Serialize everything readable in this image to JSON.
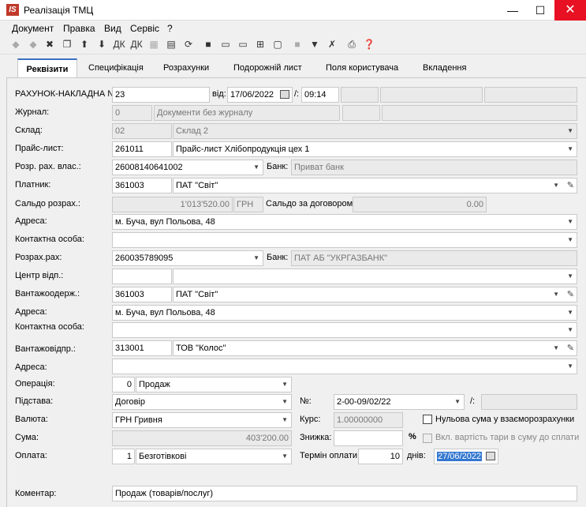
{
  "window": {
    "title": "Реалізація ТМЦ",
    "icon": "IS"
  },
  "menu": [
    "Документ",
    "Правка",
    "Вид",
    "Сервіс",
    "?"
  ],
  "tabs": [
    "Реквізити",
    "Специфікація",
    "Розрахунки",
    "Подорожній лист",
    "Поля користувача",
    "Вкладення"
  ],
  "labels": {
    "invoice": "РАХУНОК-НАКЛАДНА №:",
    "from": "від:",
    "slash": "/:",
    "journal": "Журнал:",
    "warehouse": "Склад:",
    "pricelist": "Прайс-лист:",
    "own_account": "Розр. рах. влас.:",
    "bank": "Банк:",
    "payer": "Платник:",
    "balance": "Сальдо розрах.:",
    "balance_contract": "Сальдо за договором:",
    "address": "Адреса:",
    "contact": "Контактна особа:",
    "account": "Розрах.рах:",
    "bank2": "Банк:",
    "center": "Центр відп.:",
    "consignee": "Вантажоодерж.:",
    "address2": "Адреса:",
    "contact2": "Контактна особа:",
    "shipper": "Вантажовідпр.:",
    "address3": "Адреса:",
    "operation": "Операція:",
    "basis": "Підстава:",
    "num": "№:",
    "slash2": "/:",
    "currency": "Валюта:",
    "rate": "Курс:",
    "zero_sum": "Нульова сума у взаєморозрахунки",
    "sum": "Сума:",
    "discount": "Знижка:",
    "percent": "%",
    "tare": "Вкл. вартість тари в суму до сплати",
    "payment": "Оплата:",
    "payment_term": "Термін оплати:",
    "days": "днів:",
    "comment": "Коментар:"
  },
  "values": {
    "invoice_no": "23",
    "date": "17/06/2022",
    "time": "09:14",
    "journal_code": "0",
    "journal_name": "Документи без журналу",
    "warehouse_code": "02",
    "warehouse_name": "Склад 2",
    "pricelist_code": "261011",
    "pricelist_name": "Прайс-лист Хлібопродукція цех 1",
    "own_account": "26008140641002",
    "own_bank": "Приват банк",
    "payer_code": "361003",
    "payer_name": "ПАТ \"Світ\"",
    "balance": "1'013'520.00",
    "currency_code": "ГРН",
    "balance_contract": "0.00",
    "address": "м. Буча, вул Польова, 48",
    "account": "260035789095",
    "account_bank": "ПАТ АБ \"УКРГАЗБАНК\"",
    "consignee_code": "361003",
    "consignee_name": "ПАТ \"Світ\"",
    "consignee_address": "м. Буча, вул Польова, 48",
    "shipper_code": "313001",
    "shipper_name": "ТОВ \"Колос\"",
    "operation_code": "0",
    "operation_name": "Продаж",
    "basis": "Договір",
    "basis_no": "2-00-09/02/22",
    "currency": "ГРН Гривня",
    "rate": "1.00000000",
    "sum": "403'200.00",
    "payment_code": "1",
    "payment_name": "Безготівкові",
    "payment_days": "10",
    "payment_date": "27/06/2022",
    "comment": "Продаж (товарів/послуг)"
  }
}
